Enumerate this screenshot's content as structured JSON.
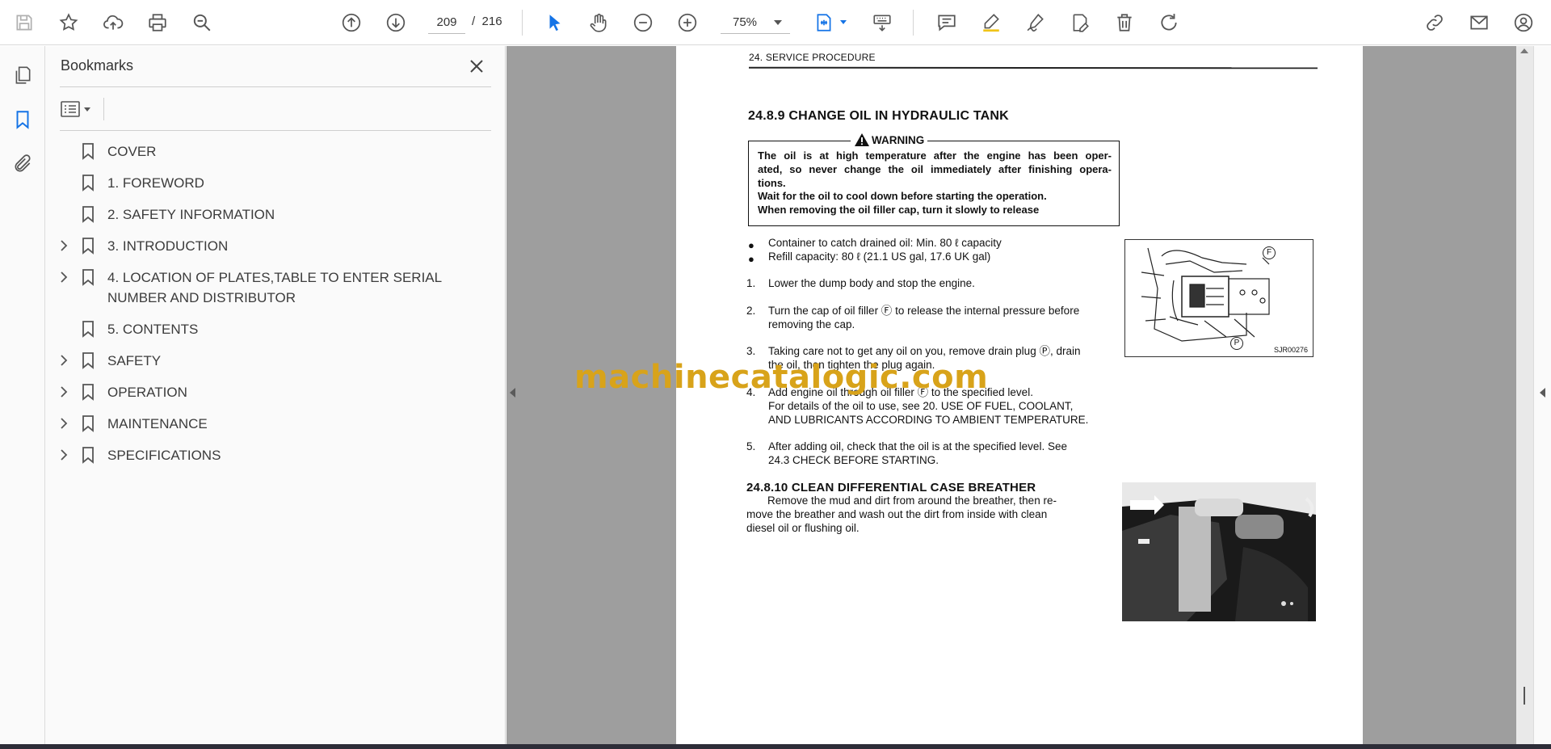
{
  "toolbar": {
    "current_page": "209",
    "page_separator": "/",
    "total_pages": "216",
    "zoom": "75%"
  },
  "bookmarks_panel": {
    "title": "Bookmarks",
    "items": [
      {
        "label": "COVER",
        "expandable": false
      },
      {
        "label": "1. FOREWORD",
        "expandable": false
      },
      {
        "label": "2. SAFETY INFORMATION",
        "expandable": false
      },
      {
        "label": "3. INTRODUCTION",
        "expandable": true
      },
      {
        "label": "4. LOCATION OF PLATES,TABLE TO ENTER SERIAL NUMBER AND DISTRIBUTOR",
        "expandable": true
      },
      {
        "label": "5. CONTENTS",
        "expandable": false
      },
      {
        "label": "SAFETY",
        "expandable": true
      },
      {
        "label": "OPERATION",
        "expandable": true
      },
      {
        "label": "MAINTENANCE",
        "expandable": true
      },
      {
        "label": "SPECIFICATIONS",
        "expandable": true
      }
    ]
  },
  "document": {
    "header": "24. SERVICE PROCEDURE",
    "section_title": "24.8.9  CHANGE OIL IN HYDRAULIC TANK",
    "warning_title": "WARNING",
    "warning_lines": [
      "The oil is at high temperature after the engine has been oper-",
      "ated, so never change the oil immediately after finishing opera-",
      "tions.",
      "Wait for the oil to cool down before starting the operation.",
      "When removing the oil filler cap, turn it slowly to release"
    ],
    "bullets": [
      "Container to catch drained oil: Min. 80 ℓ capacity",
      "Refill capacity: 80 ℓ (21.1 US gal, 17.6 UK gal)"
    ],
    "steps": [
      {
        "num": "1.",
        "lines": [
          "Lower the dump body and stop the engine."
        ]
      },
      {
        "num": "2.",
        "lines": [
          "Turn the cap of oil filler Ⓕ to release the internal pressure before",
          "removing the cap."
        ]
      },
      {
        "num": "3.",
        "lines": [
          "Taking care not to get any oil on you, remove drain plug Ⓟ, drain",
          "the oil, then tighten the plug again."
        ]
      },
      {
        "num": "4.",
        "lines": [
          "Add engine oil through oil filler Ⓕ to the specified level.",
          "For details of the oil to use, see 20. USE OF FUEL, COOLANT,",
          "AND LUBRICANTS ACCORDING TO AMBIENT TEMPERATURE."
        ]
      },
      {
        "num": "5.",
        "lines": [
          "After adding oil, check that the oil is at the specified level. See",
          "24.3 CHECK BEFORE STARTING."
        ]
      }
    ],
    "section2_title": "24.8.10 CLEAN DIFFERENTIAL CASE BREATHER",
    "section2_lines": [
      "Remove the mud and dirt from around the breather, then re-",
      "move the breather and wash out the dirt from inside with clean",
      "diesel oil or flushing oil."
    ],
    "figure1_label_f": "F",
    "figure1_label_p": "P",
    "figure1_caption": "SJR00276",
    "watermark": "machinecatalogic.com"
  }
}
